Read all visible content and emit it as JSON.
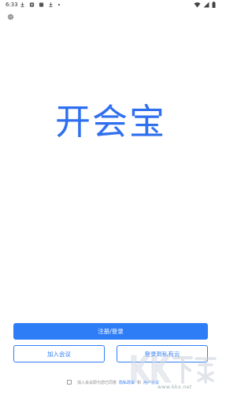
{
  "status_bar": {
    "time": "6:33",
    "left_icons": [
      "download-icon",
      "app-icon",
      "app-icon",
      "download-icon",
      "dot-icon"
    ],
    "right_icons": [
      "wifi-icon",
      "signal-icon",
      "battery-icon"
    ]
  },
  "header": {
    "settings_icon": "gear-icon"
  },
  "logo": {
    "text": "开会宝"
  },
  "buttons": {
    "register_login": "注册/登录",
    "join_meeting": "加入会议",
    "private_cloud": "登录到私有云"
  },
  "agreement": {
    "prefix": "加入会议即为您已同意",
    "privacy": "隐私政策",
    "and": "和",
    "terms": "用户协议"
  },
  "watermark": {
    "logo_text": "KK下载",
    "domain": "www.kkx.net"
  },
  "colors": {
    "accent": "#2f7df6",
    "logo": "#2f6ff0"
  }
}
